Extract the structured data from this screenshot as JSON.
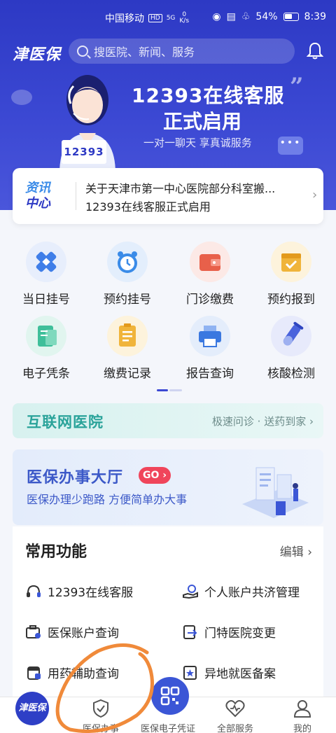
{
  "status_bar": {
    "carrier": "中国移动",
    "network": "HD",
    "signal": "5G",
    "speed_value": "0",
    "speed_unit": "K/s",
    "battery": "54%",
    "time": "8:39"
  },
  "header": {
    "app_name": "津医保",
    "search_placeholder": "搜医院、新闻、服务"
  },
  "banner": {
    "title_line1": "12393在线客服",
    "title_line2": "正式启用",
    "subtitle": "一对一聊天 享真诚服务",
    "sign_text": "12393",
    "chat_bubble": "•••"
  },
  "news": {
    "tag_line1": "资讯",
    "tag_line2": "中心",
    "items": [
      "关于天津市第一中心医院部分科室搬...",
      "12393在线客服正式启用"
    ]
  },
  "services": [
    {
      "label": "当日挂号",
      "icon": "hospital-cross-icon",
      "color": "#3f7ee8"
    },
    {
      "label": "预约挂号",
      "icon": "alarm-clock-icon",
      "color": "#3a8be8"
    },
    {
      "label": "门诊缴费",
      "icon": "wallet-icon",
      "color": "#e8604a"
    },
    {
      "label": "预约报到",
      "icon": "calendar-icon",
      "color": "#f0b43a"
    },
    {
      "label": "电子凭条",
      "icon": "receipt-icon",
      "color": "#3fbf9a"
    },
    {
      "label": "缴费记录",
      "icon": "notepad-icon",
      "color": "#f0b43a"
    },
    {
      "label": "报告查询",
      "icon": "printer-icon",
      "color": "#3a78e0"
    },
    {
      "label": "核酸检测",
      "icon": "test-tube-icon",
      "color": "#4a63dc"
    }
  ],
  "internet_hospital": {
    "title": "互联网医院",
    "subtitle": "极速问诊 · 送药到家"
  },
  "service_hall": {
    "title": "医保办事大厅",
    "go_label": "GO",
    "subtitle": "医保办理少跑路 方便简单办大事"
  },
  "common_functions": {
    "title": "常用功能",
    "edit_label": "编辑",
    "items": [
      {
        "label": "12393在线客服",
        "icon": "headset-icon"
      },
      {
        "label": "个人账户共济管理",
        "icon": "hand-money-icon"
      },
      {
        "label": "医保账户查询",
        "icon": "account-search-icon"
      },
      {
        "label": "门特医院变更",
        "icon": "document-swap-icon"
      },
      {
        "label": "用药辅助查询",
        "icon": "medicine-icon"
      },
      {
        "label": "异地就医备案",
        "icon": "star-document-icon"
      }
    ]
  },
  "bottom_nav": {
    "home": "津医保",
    "tabs": [
      "医保办事",
      "医保电子凭证",
      "全部服务",
      "我的"
    ]
  }
}
